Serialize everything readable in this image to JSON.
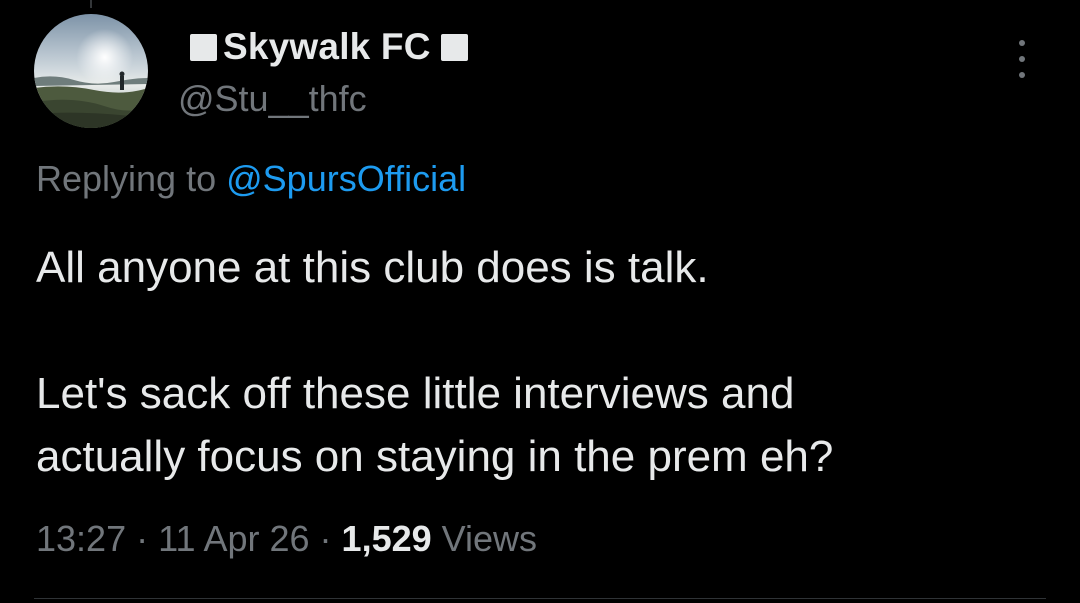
{
  "tweet": {
    "display_name": "Skywalk FC",
    "handle": "@Stu__thfc",
    "reply_prefix": "Replying to",
    "reply_mention": "@SpursOfficial",
    "paragraphs": [
      "All anyone at this club does is talk.",
      "Let's sack off these little interviews and",
      "actually focus on staying in the prem eh?"
    ],
    "time": "13:27",
    "date": "11 Apr 26",
    "separator": " · ",
    "views_count": "1,529",
    "views_label": "Views"
  },
  "icons": {
    "name_prefix": "white-square-icon",
    "name_suffix": "white-square-icon",
    "menu": "more-options-icon"
  },
  "colors": {
    "background": "#000000",
    "primary_text": "#e7e9ea",
    "secondary_text": "#71767b",
    "accent_link": "#1d9bf0",
    "divider": "#2f3336"
  }
}
